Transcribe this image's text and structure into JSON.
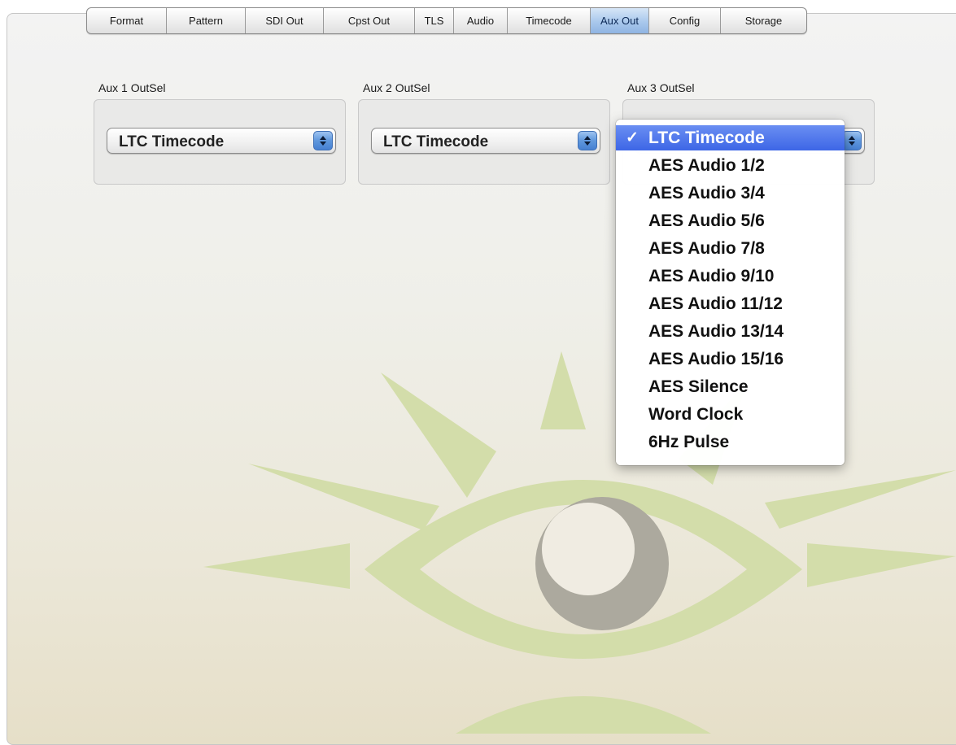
{
  "tabs": [
    {
      "label": "Format"
    },
    {
      "label": "Pattern"
    },
    {
      "label": "SDI Out"
    },
    {
      "label": "Cpst Out"
    },
    {
      "label": "TLS"
    },
    {
      "label": "Audio"
    },
    {
      "label": "Timecode"
    },
    {
      "label": "Aux Out",
      "active": true
    },
    {
      "label": "Config"
    },
    {
      "label": "Storage"
    }
  ],
  "groups": [
    {
      "label": "Aux 1 OutSel",
      "value": "LTC Timecode"
    },
    {
      "label": "Aux 2 OutSel",
      "value": "LTC Timecode"
    },
    {
      "label": "Aux 3 OutSel",
      "value": "LTC Timecode"
    }
  ],
  "menu": {
    "selected_index": 0,
    "check_glyph": "✓",
    "items": [
      "LTC Timecode",
      "AES Audio 1/2",
      "AES Audio 3/4",
      "AES Audio 5/6",
      "AES Audio 7/8",
      "AES Audio 9/10",
      "AES Audio 11/12",
      "AES Audio 13/14",
      "AES Audio 15/16",
      "AES Silence",
      "Word Clock",
      "6Hz Pulse"
    ]
  },
  "colors": {
    "accent": "#3d66e6",
    "active_tab": "#a9c8ec",
    "watermark_green": "#cfdba0",
    "watermark_gray": "#aaa59a"
  },
  "icons": {
    "watermark": "eye-logo-icon",
    "popup_arrows": "up-down-arrows-icon"
  }
}
